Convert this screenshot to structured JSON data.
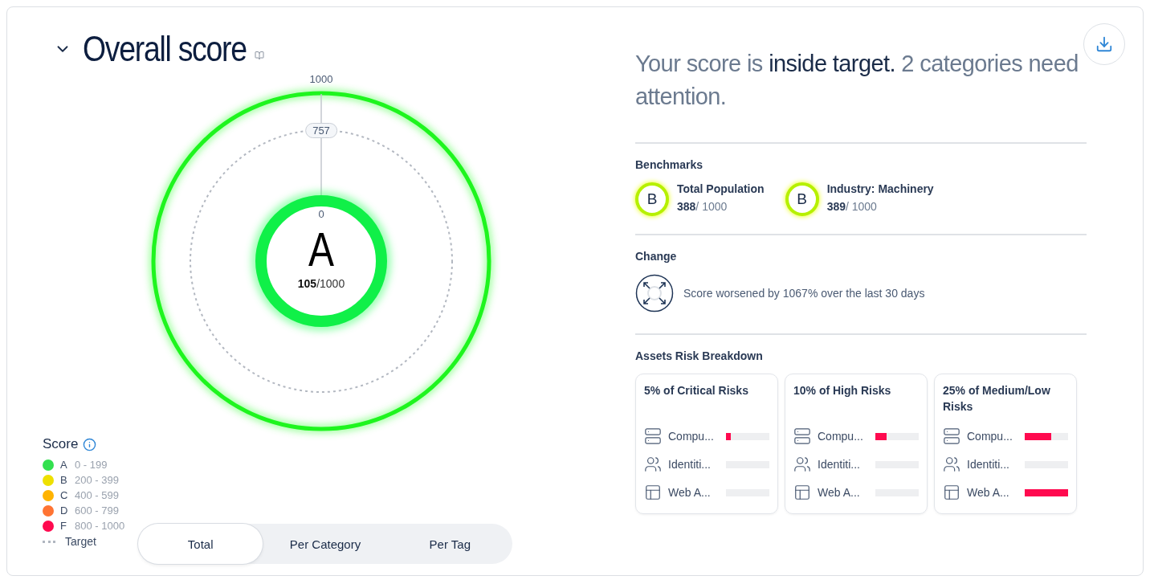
{
  "header": {
    "title": "Overall score"
  },
  "gauge": {
    "scale_max": "1000",
    "target": "757",
    "scale_min": "0",
    "grade": "A",
    "score": "**105**/1000"
  },
  "legend": {
    "title": "Score",
    "items": [
      {
        "grade": "A",
        "range": "0 - 199",
        "color": "#33e04f"
      },
      {
        "grade": "B",
        "range": "200 - 399",
        "color": "#eee000"
      },
      {
        "grade": "C",
        "range": "400 - 599",
        "color": "#ffb300"
      },
      {
        "grade": "D",
        "range": "600 - 799",
        "color": "#ff7433"
      },
      {
        "grade": "F",
        "range": "800 - 1000",
        "color": "#ff0a4f"
      }
    ],
    "target_label": "Target"
  },
  "view_tabs": [
    {
      "label": "Total",
      "selected": true
    },
    {
      "label": "Per Category",
      "selected": false
    },
    {
      "label": "Per Tag",
      "selected": false
    }
  ],
  "summary": "Your score is **inside target.** 2 categories need attention.",
  "benchmarks": {
    "title": "Benchmarks",
    "items": [
      {
        "grade": "B",
        "name": "Total Population",
        "score": "**388**/ 1000"
      },
      {
        "grade": "B",
        "name": "Industry: Machinery",
        "score": "**389**/ 1000"
      }
    ]
  },
  "change": {
    "title": "Change",
    "text": "Score worsened by 1067% over the last 30 days"
  },
  "assets": {
    "title": "Assets Risk Breakdown",
    "cards": [
      {
        "title": "5% of Critical Risks",
        "rows": [
          {
            "kind": "server",
            "label": "Compu...",
            "level": 0.12
          },
          {
            "kind": "users",
            "label": "Identiti..."
          },
          {
            "kind": "layout",
            "label": "Web A..."
          }
        ]
      },
      {
        "title": "10% of High Risks",
        "rows": [
          {
            "kind": "server",
            "label": "Compu...",
            "level": 0.25
          },
          {
            "kind": "users",
            "label": "Identiti..."
          },
          {
            "kind": "layout",
            "label": "Web A..."
          }
        ]
      },
      {
        "title": "25% of Medium/Low Risks",
        "rows": [
          {
            "kind": "server",
            "label": "Compu...",
            "level": 0.62
          },
          {
            "kind": "users",
            "label": "Identiti..."
          },
          {
            "kind": "layout",
            "label": "Web A...",
            "level": 1
          }
        ]
      }
    ]
  }
}
